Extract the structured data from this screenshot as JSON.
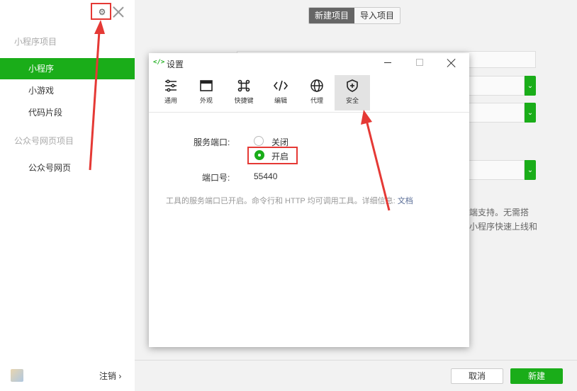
{
  "sidebar": {
    "section_miniprogram": "小程序项目",
    "items_miniprogram": [
      "小程序",
      "小游戏",
      "代码片段"
    ],
    "section_official": "公众号网页项目",
    "items_official": [
      "公众号网页"
    ],
    "logout_label": "注销 ›"
  },
  "main": {
    "tab_new": "新建项目",
    "tab_import": "导入项目",
    "bg_text_1": "端支持。无需搭",
    "bg_text_2": "小程序快速上线和",
    "cancel_label": "取消",
    "create_label": "新建"
  },
  "dialog": {
    "app_icon": "</>",
    "title": "设置",
    "tabs": [
      {
        "label": "通用",
        "icon": "sliders-icon"
      },
      {
        "label": "外观",
        "icon": "window-icon"
      },
      {
        "label": "快捷键",
        "icon": "command-icon"
      },
      {
        "label": "编辑",
        "icon": "code-icon"
      },
      {
        "label": "代理",
        "icon": "globe-icon"
      },
      {
        "label": "安全",
        "icon": "shield-icon"
      }
    ],
    "active_tab": "安全",
    "service_port_label": "服务端口:",
    "option_off": "关闭",
    "option_on": "开启",
    "selected_option": "开启",
    "port_label": "端口号:",
    "port_value": "55440",
    "hint_text": "工具的服务端口已开启。命令行和 HTTP 均可调用工具。详细信息: ",
    "hint_link": "文档"
  },
  "annotation_color": "#e53935",
  "accent_color": "#1aad19"
}
